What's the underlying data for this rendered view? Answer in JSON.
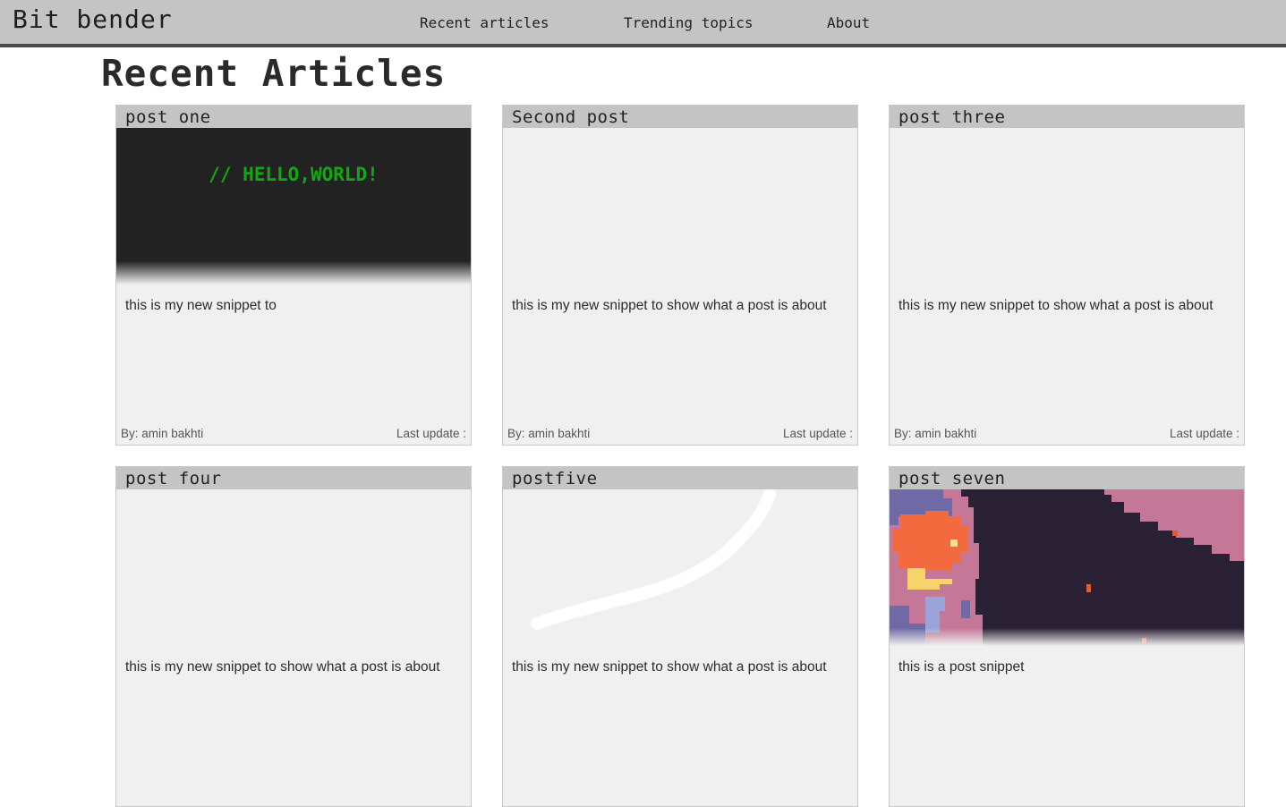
{
  "header": {
    "brand": "Bit bender",
    "nav": [
      {
        "label": "Recent articles"
      },
      {
        "label": "Trending topics"
      },
      {
        "label": "About"
      }
    ]
  },
  "main": {
    "title": "Recent Articles",
    "posts": [
      {
        "title": "post one",
        "image_text": "// HELLO,WORLD!",
        "snippet": "this is my new snippet to",
        "author": "By: amin bakhti",
        "updated": "Last update :"
      },
      {
        "title": "Second post",
        "snippet": "this is my new snippet to show what a post is about",
        "author": "By: amin bakhti",
        "updated": "Last update :"
      },
      {
        "title": "post three",
        "snippet": "this is my new snippet to show what a post is about",
        "author": "By: amin bakhti",
        "updated": "Last update :"
      },
      {
        "title": "post four",
        "snippet": "this is my new snippet to show what a post is about"
      },
      {
        "title": "postfive",
        "snippet": "this is my new snippet to show what a post is about"
      },
      {
        "title": "post seven",
        "snippet": "this is a post snippet"
      }
    ]
  },
  "colors": {
    "header_bg": "#c4c4c4",
    "header_border": "#4a4a4a",
    "card_bg": "#f0f0f0",
    "card_title_bg": "#c4c4c4",
    "code_green": "#12a812"
  }
}
